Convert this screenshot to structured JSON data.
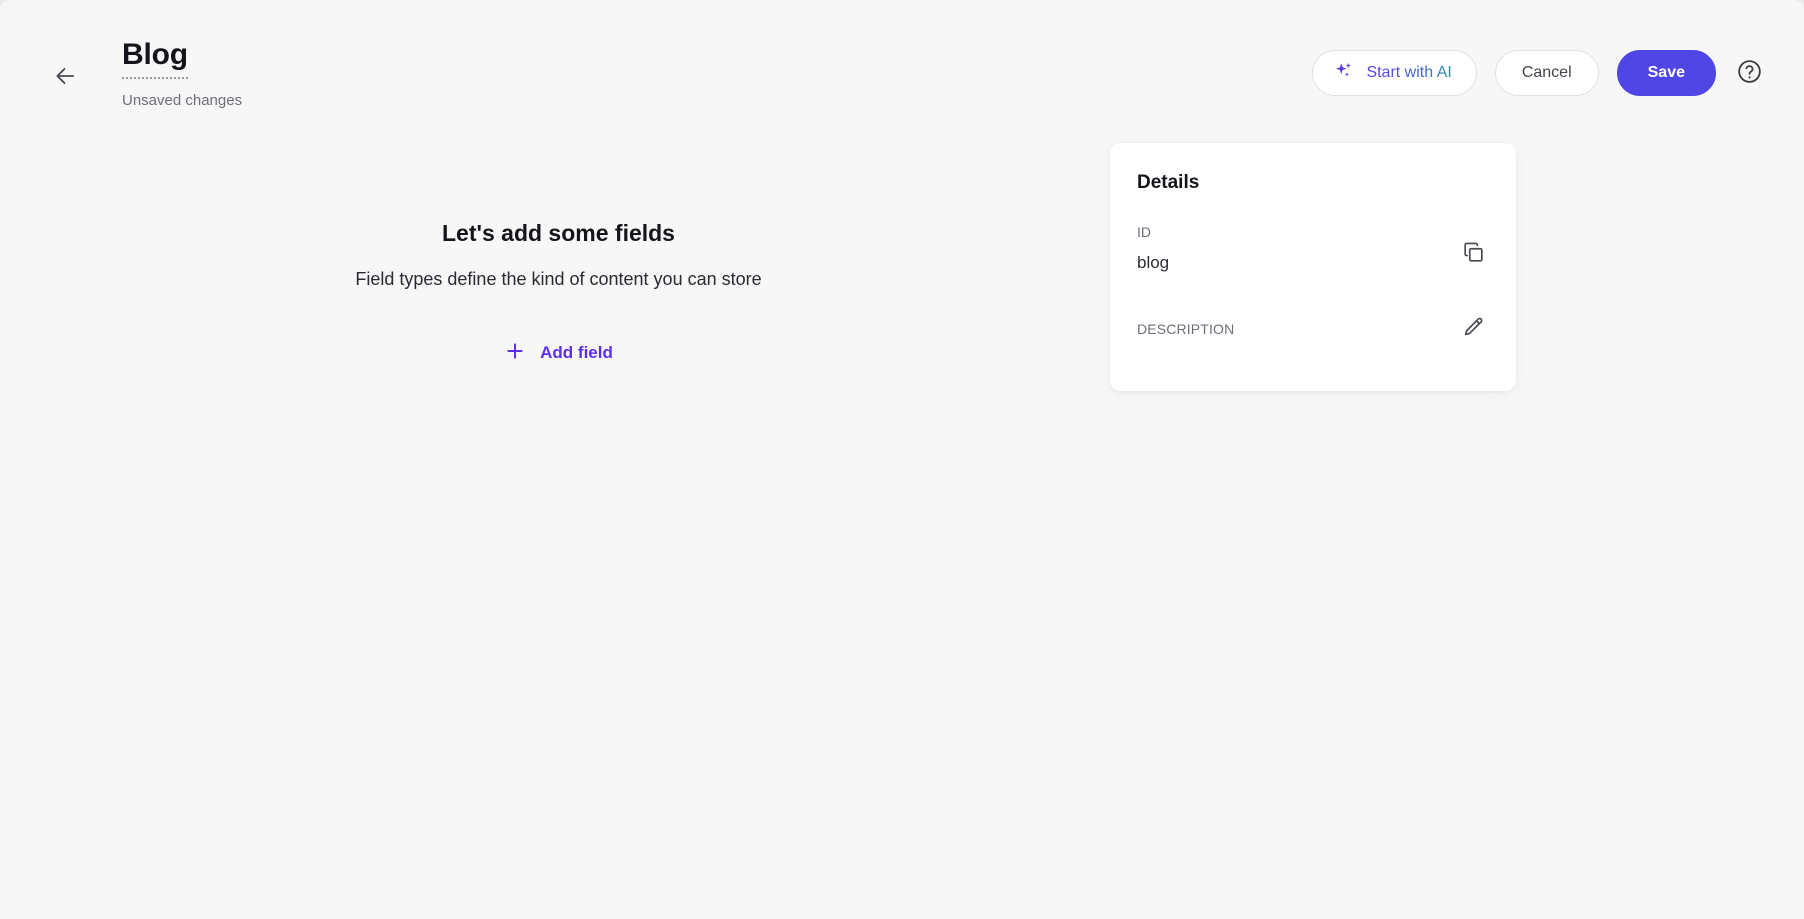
{
  "header": {
    "back_icon": "arrow-left-icon",
    "title": "Blog",
    "status": "Unsaved changes",
    "actions": {
      "ai_icon": "sparkles-icon",
      "ai_label": "Start with AI",
      "cancel_label": "Cancel",
      "save_label": "Save",
      "help_icon": "help-circle-icon"
    }
  },
  "empty_state": {
    "title": "Let's add some fields",
    "description": "Field types define the kind of content you can store",
    "add_icon": "plus-icon",
    "add_label": "Add field"
  },
  "details": {
    "heading": "Details",
    "id_label": "ID",
    "id_value": "blog",
    "copy_icon": "copy-icon",
    "description_label": "DESCRIPTION",
    "edit_icon": "pencil-icon"
  },
  "colors": {
    "background": "#f7f7f7",
    "card": "#ffffff",
    "accent_save": "#5046e5",
    "accent_link": "#5b2fe8",
    "text_primary": "#15141a",
    "text_muted": "#6e6d7a",
    "border": "#e2e2e6"
  }
}
